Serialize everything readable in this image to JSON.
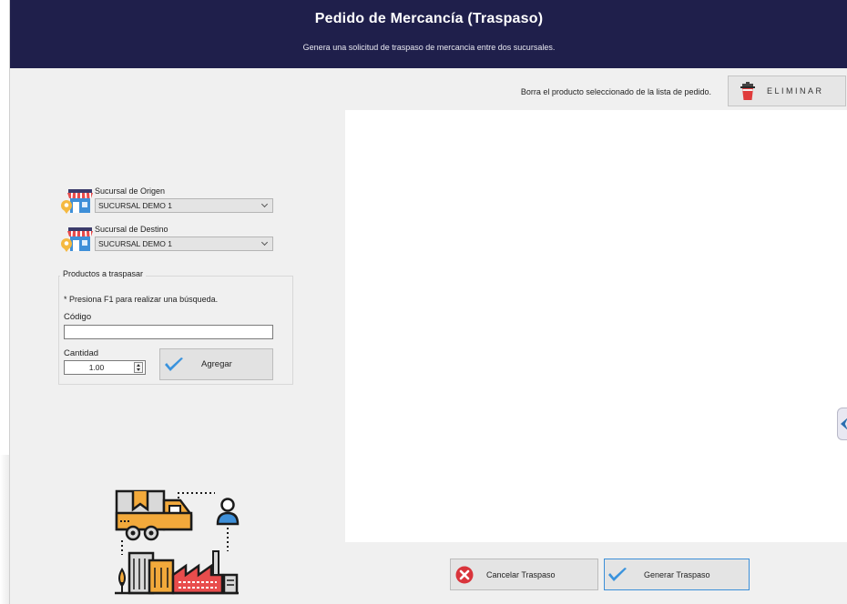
{
  "header": {
    "title": "Pedido de Mercancía (Traspaso)",
    "subtitle": "Genera una solicitud de traspaso de mercancia entre dos sucursales."
  },
  "toolbar": {
    "delete_hint": "Borra el producto seleccionado de la lista de pedido.",
    "delete_label": "ELIMINAR"
  },
  "origin": {
    "label": "Sucursal de Origen",
    "selected": "SUCURSAL DEMO 1"
  },
  "destination": {
    "label": "Sucursal de Destino",
    "selected": "SUCURSAL DEMO 1"
  },
  "products": {
    "group_title": "Productos a traspasar",
    "f1_hint": "* Presiona F1 para realizar una búsqueda.",
    "code_label": "Código",
    "code_value": "",
    "quantity_label": "Cantidad",
    "quantity_value": "1.00",
    "add_label": "Agregar"
  },
  "footer": {
    "cancel_label": "Cancelar Traspaso",
    "generate_label": "Generar Traspaso"
  },
  "colors": {
    "header_bg": "#1f1f4b",
    "accent_blue": "#3c8fd8",
    "cancel_red": "#d9343b",
    "check_blue": "#3a93dd"
  },
  "icons": {
    "delete": "trash-cup-icon",
    "store": "store-location-icon",
    "add": "check-icon",
    "cancel": "x-circle-icon",
    "generate": "check-icon",
    "illustration": "delivery-truck-factory-icon"
  }
}
